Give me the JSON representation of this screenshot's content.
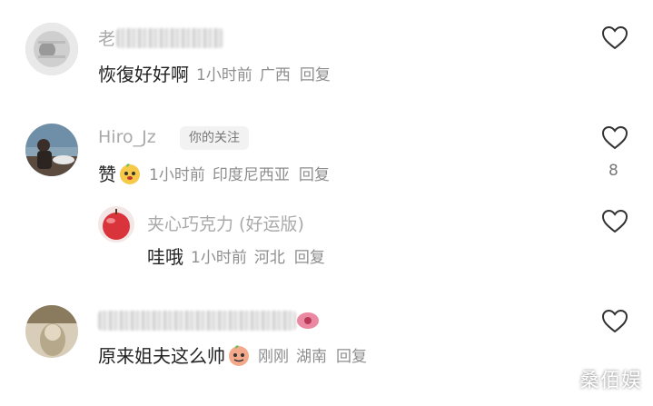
{
  "comments": [
    {
      "username": "老",
      "text": "恢復好好啊",
      "time": "1小时前",
      "location": "广西",
      "reply_label": "回复"
    },
    {
      "username": "Hiro_Jz",
      "badge": "你的关注",
      "text": "赞",
      "time": "1小时前",
      "location": "印度尼西亚",
      "reply_label": "回复",
      "likes": "8"
    },
    {
      "username": "夹心巧克力 (好运版)",
      "text": "哇哦",
      "time": "1小时前",
      "location": "河北",
      "reply_label": "回复"
    },
    {
      "username": "",
      "text": "原来姐夫这么帅",
      "time": "刚刚",
      "location": "湖南",
      "reply_label": "回复"
    }
  ],
  "watermark": "桑佰娱",
  "colors": {
    "meta": "#8e8e8e",
    "username": "#a9a9a9",
    "heart": "#333333"
  },
  "icons": {
    "like": "heart-icon",
    "emoji": "peach-emoji-icon"
  }
}
